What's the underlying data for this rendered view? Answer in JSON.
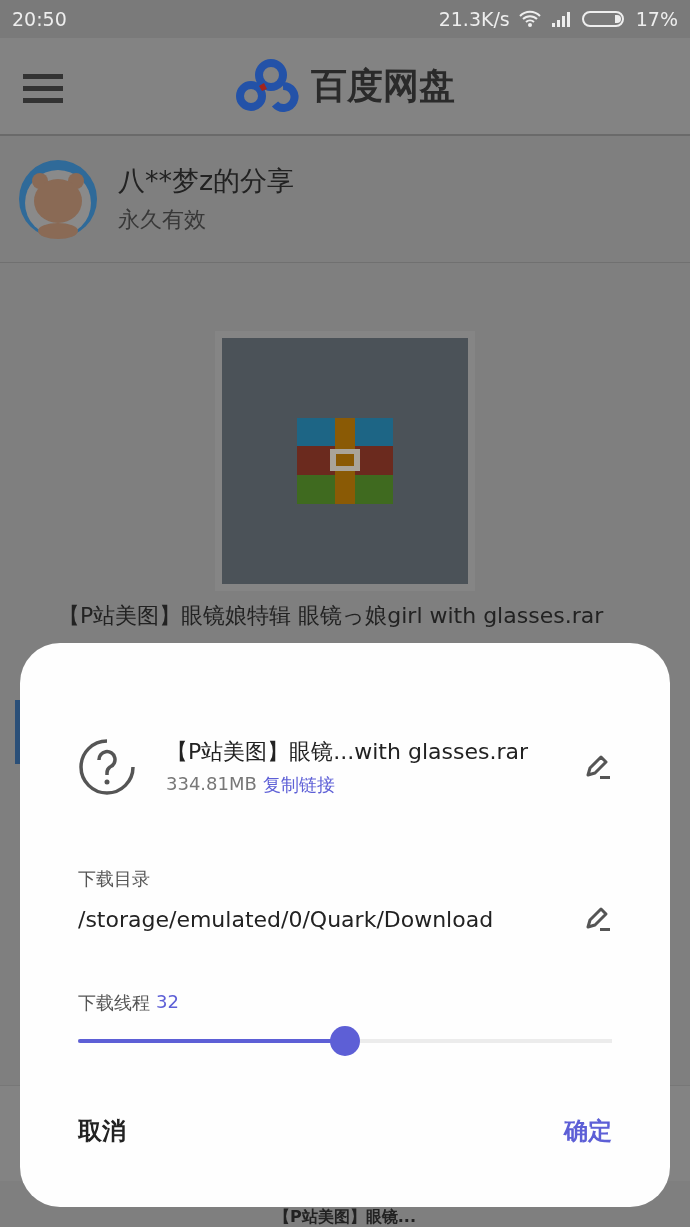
{
  "status_bar": {
    "time": "20:50",
    "speed": "21.3K/s",
    "battery": "17%"
  },
  "header": {
    "title": "百度网盘"
  },
  "share": {
    "owner": "八**梦z的分享",
    "validity": "永久有效"
  },
  "file_name": "【P站美图】眼镜娘特辑 眼镜っ娘girl with glasses.rar",
  "bottom_text": "【P站美图】眼镜...",
  "dialog": {
    "file_name": "【P站美图】眼镜...with glasses.rar",
    "size": "334.81MB",
    "copy_link": "复制链接",
    "dir_label": "下载目录",
    "dir_path": "/storage/emulated/0/Quark/Download",
    "threads_label": "下载线程",
    "threads_value": "32",
    "threads": {
      "level": 0.5
    },
    "buttons": [
      {
        "label": "取消",
        "kind": "cancel"
      },
      {
        "label": "确定",
        "kind": "confirm"
      }
    ]
  }
}
